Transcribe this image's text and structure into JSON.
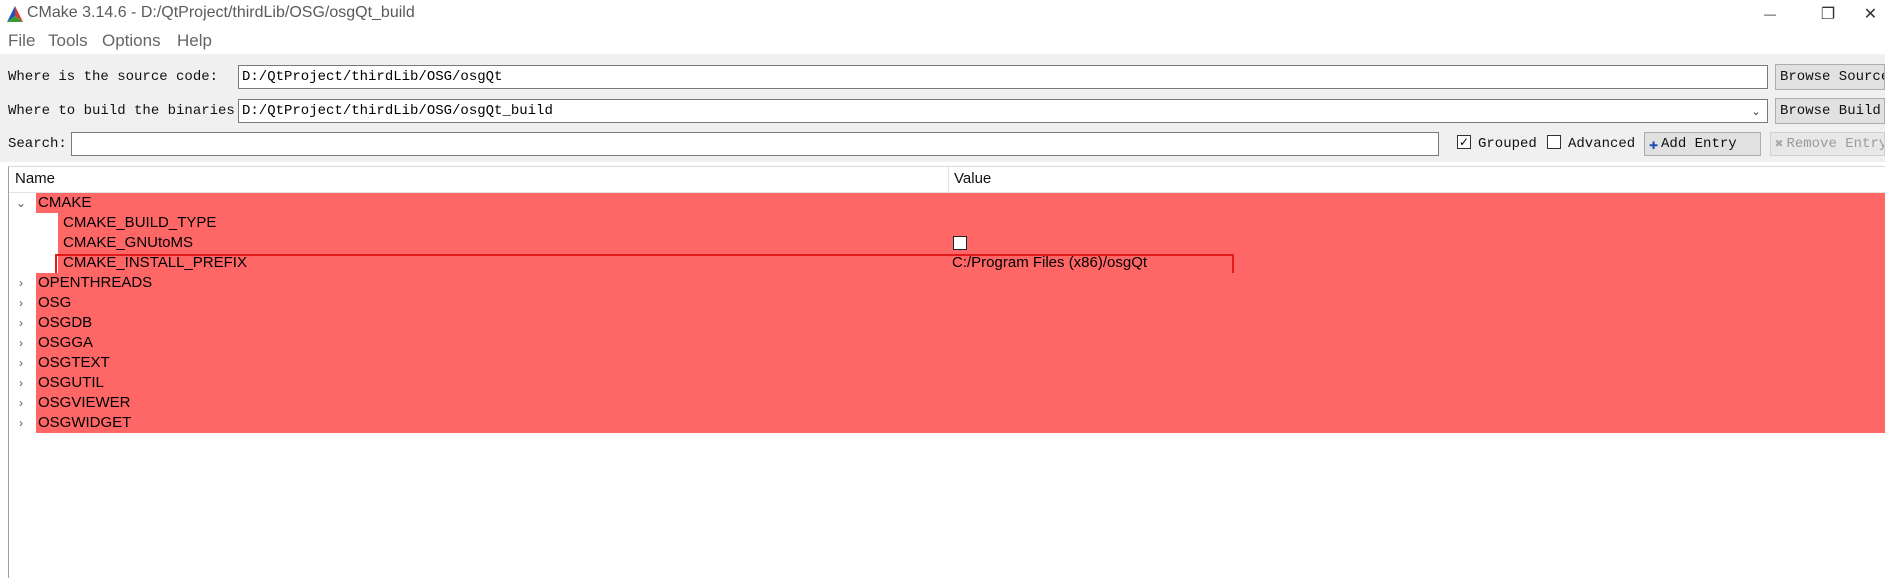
{
  "window": {
    "title": "CMake 3.14.6 - D:/QtProject/thirdLib/OSG/osgQt_build",
    "minimize_glyph": "—",
    "restore_glyph": "❐",
    "close_glyph": "✕"
  },
  "menu": {
    "items": [
      {
        "label": "File"
      },
      {
        "label": "Tools"
      },
      {
        "label": "Options"
      },
      {
        "label": "Help"
      }
    ]
  },
  "source": {
    "label": "Where is the source code:",
    "value": "D:/QtProject/thirdLib/OSG/osgQt",
    "button": "Browse Source..."
  },
  "build": {
    "label": "Where to build the binaries:",
    "value": "D:/QtProject/thirdLib/OSG/osgQt_build",
    "button": "Browse Build..."
  },
  "search": {
    "label": "Search:",
    "value": ""
  },
  "options": {
    "grouped_label": "Grouped",
    "grouped_checked": true,
    "advanced_label": "Advanced",
    "advanced_checked": false,
    "add_entry": "Add Entry",
    "remove_entry": "Remove Entry"
  },
  "tree": {
    "columns": {
      "name": "Name",
      "value": "Value"
    },
    "highlight_color": "#ff6666",
    "groups": [
      {
        "name": "CMAKE",
        "expanded": true,
        "children": [
          {
            "name": "CMAKE_BUILD_TYPE",
            "value": ""
          },
          {
            "name": "CMAKE_GNUtoMS",
            "value": "",
            "checkbox": true
          },
          {
            "name": "CMAKE_INSTALL_PREFIX",
            "value": "C:/Program Files (x86)/osgQt"
          }
        ]
      },
      {
        "name": "OPENTHREADS",
        "expanded": false
      },
      {
        "name": "OSG",
        "expanded": false
      },
      {
        "name": "OSGDB",
        "expanded": false
      },
      {
        "name": "OSGGA",
        "expanded": false
      },
      {
        "name": "OSGTEXT",
        "expanded": false
      },
      {
        "name": "OSGUTIL",
        "expanded": false
      },
      {
        "name": "OSGVIEWER",
        "expanded": false
      },
      {
        "name": "OSGWIDGET",
        "expanded": false
      }
    ]
  },
  "colors": {
    "row_highlight": "#ff6666",
    "selection_border": "#e21b1b",
    "toolbar_bg": "#f0f0f0"
  }
}
